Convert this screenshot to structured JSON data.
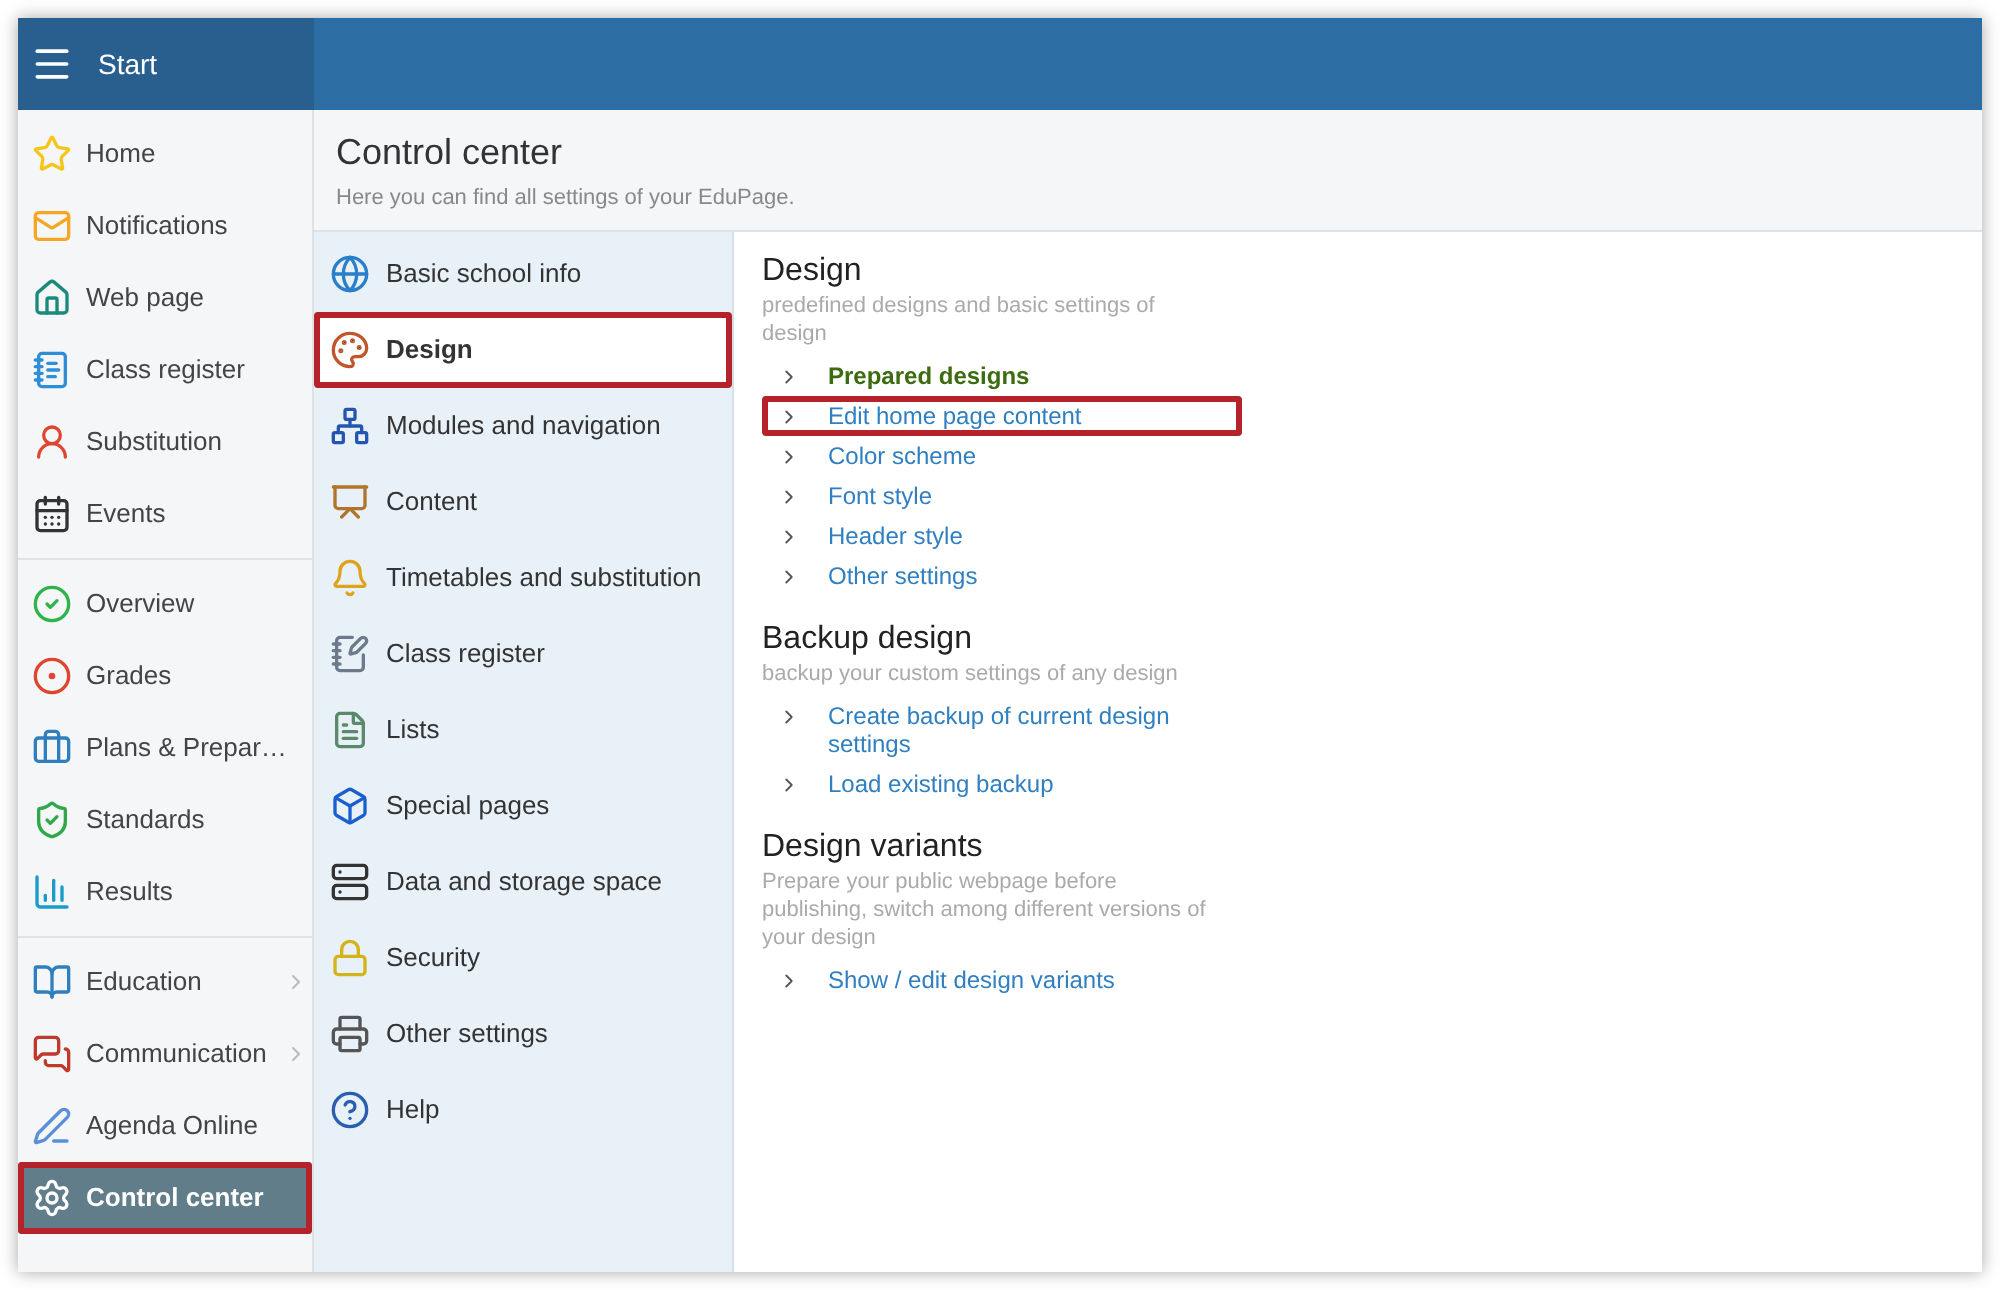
{
  "header": {
    "menu_label": "Start"
  },
  "sidebar": {
    "groups": [
      {
        "items": [
          {
            "label": "Home",
            "selected": false,
            "expandable": false,
            "highlighted": false
          },
          {
            "label": "Notifications",
            "selected": false,
            "expandable": false,
            "highlighted": false
          },
          {
            "label": "Web page",
            "selected": false,
            "expandable": false,
            "highlighted": false
          },
          {
            "label": "Class register",
            "selected": false,
            "expandable": false,
            "highlighted": false
          },
          {
            "label": "Substitution",
            "selected": false,
            "expandable": false,
            "highlighted": false
          },
          {
            "label": "Events",
            "selected": false,
            "expandable": false,
            "highlighted": false
          }
        ]
      },
      {
        "items": [
          {
            "label": "Overview",
            "selected": false,
            "expandable": false,
            "highlighted": false
          },
          {
            "label": "Grades",
            "selected": false,
            "expandable": false,
            "highlighted": false
          },
          {
            "label": "Plans & Prepar…",
            "selected": false,
            "expandable": false,
            "highlighted": false
          },
          {
            "label": "Standards",
            "selected": false,
            "expandable": false,
            "highlighted": false
          },
          {
            "label": "Results",
            "selected": false,
            "expandable": false,
            "highlighted": false
          }
        ]
      },
      {
        "items": [
          {
            "label": "Education",
            "selected": false,
            "expandable": true,
            "highlighted": false
          },
          {
            "label": "Communication",
            "selected": false,
            "expandable": true,
            "highlighted": false
          },
          {
            "label": "Agenda Online",
            "selected": false,
            "expandable": false,
            "highlighted": false
          },
          {
            "label": "Control center",
            "selected": true,
            "expandable": false,
            "highlighted": true
          }
        ]
      }
    ]
  },
  "page": {
    "title": "Control center",
    "subtitle": "Here you can find all settings of your EduPage."
  },
  "categories": [
    {
      "label": "Basic school info",
      "selected": false,
      "highlighted": false
    },
    {
      "label": "Design",
      "selected": true,
      "highlighted": true
    },
    {
      "label": "Modules and navigation",
      "selected": false,
      "highlighted": false
    },
    {
      "label": "Content",
      "selected": false,
      "highlighted": false
    },
    {
      "label": "Timetables and substitution",
      "selected": false,
      "highlighted": false
    },
    {
      "label": "Class register",
      "selected": false,
      "highlighted": false
    },
    {
      "label": "Lists",
      "selected": false,
      "highlighted": false
    },
    {
      "label": "Special pages",
      "selected": false,
      "highlighted": false
    },
    {
      "label": "Data and storage space",
      "selected": false,
      "highlighted": false
    },
    {
      "label": "Security",
      "selected": false,
      "highlighted": false
    },
    {
      "label": "Other settings",
      "selected": false,
      "highlighted": false
    },
    {
      "label": "Help",
      "selected": false,
      "highlighted": false
    }
  ],
  "sections": [
    {
      "title": "Design",
      "description": "predefined designs and basic settings of design",
      "links": [
        {
          "label": "Prepared designs",
          "selected": true,
          "highlighted": false
        },
        {
          "label": "Edit home page content",
          "selected": false,
          "highlighted": true
        },
        {
          "label": "Color scheme",
          "selected": false,
          "highlighted": false
        },
        {
          "label": "Font style",
          "selected": false,
          "highlighted": false
        },
        {
          "label": "Header style",
          "selected": false,
          "highlighted": false
        },
        {
          "label": "Other settings",
          "selected": false,
          "highlighted": false
        }
      ]
    },
    {
      "title": "Backup design",
      "description": "backup your custom settings of any design",
      "links": [
        {
          "label": "Create backup of current design settings",
          "selected": false,
          "highlighted": false
        },
        {
          "label": "Load existing backup",
          "selected": false,
          "highlighted": false
        }
      ]
    },
    {
      "title": "Design variants",
      "description": "Prepare your public webpage before publishing, switch among different versions of your design",
      "links": [
        {
          "label": "Show / edit design variants",
          "selected": false,
          "highlighted": false
        }
      ]
    }
  ]
}
